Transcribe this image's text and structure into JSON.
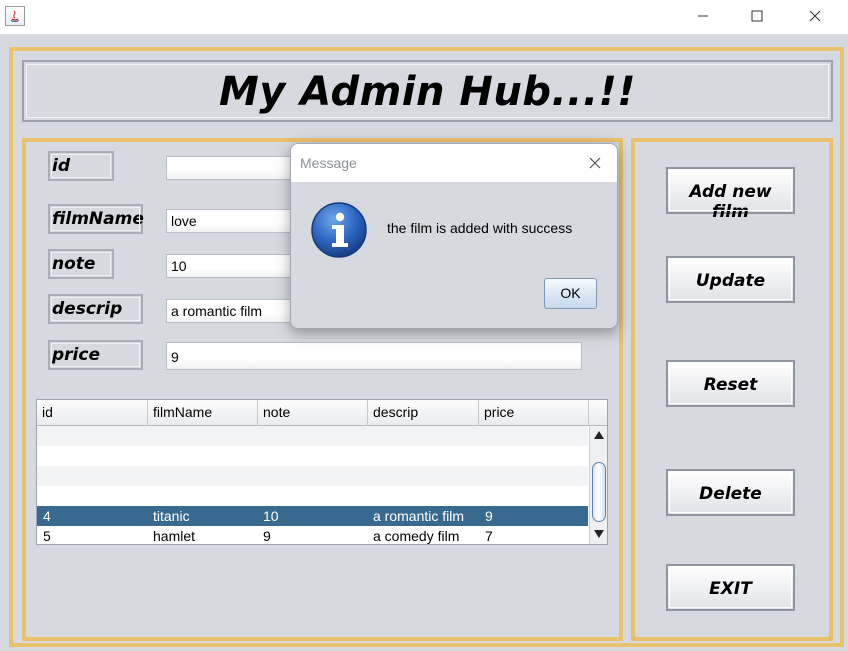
{
  "window": {
    "title": ""
  },
  "header": {
    "title": "My Admin Hub...!!"
  },
  "form": {
    "fields": [
      {
        "label": "id",
        "value": ""
      },
      {
        "label": "filmName",
        "value": "love"
      },
      {
        "label": "note",
        "value": "10"
      },
      {
        "label": "descrip",
        "value": "a romantic film"
      },
      {
        "label": "price",
        "value": "9"
      }
    ]
  },
  "table": {
    "columns": [
      "id",
      "filmName",
      "note",
      "descrip",
      "price"
    ],
    "rows": [
      [
        "4",
        "titanic",
        "10",
        "a romantic film",
        "9"
      ],
      [
        "5",
        "hamlet",
        "9",
        "a comedy film",
        "7"
      ]
    ],
    "selected_row": 0,
    "selection_color": "#386a8f"
  },
  "actions": {
    "add": "Add new film",
    "update": "Update",
    "reset": "Reset",
    "delete": "Delete",
    "exit": "EXIT"
  },
  "dialog": {
    "title": "Message",
    "message": "the film is added with success",
    "ok_label": "OK",
    "icon": "info-icon"
  },
  "colors": {
    "accent_border": "#e7c26a",
    "panel_bg": "#d6d9e0"
  }
}
